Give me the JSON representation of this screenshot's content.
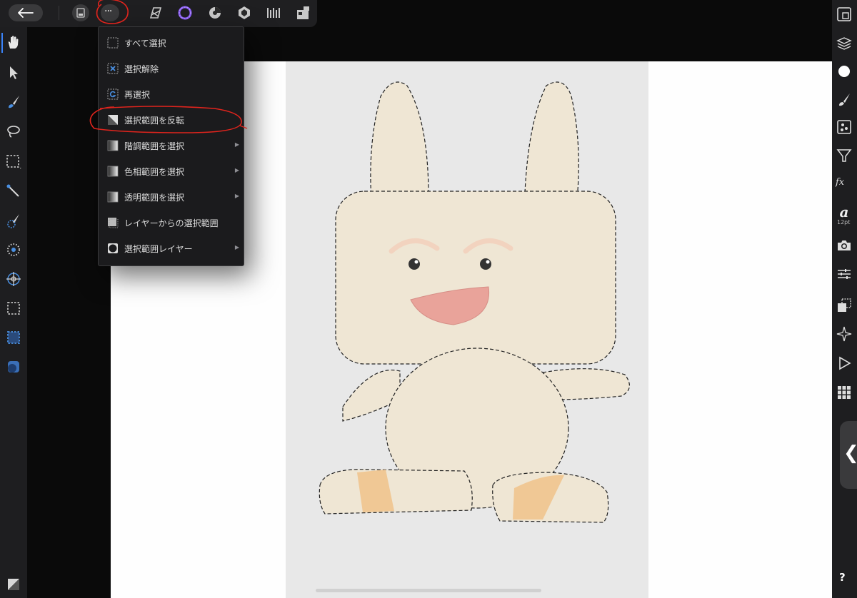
{
  "toolbar": {
    "back_icon": "arrow-left-icon",
    "document_icon": "document-icon",
    "more_icon": "ellipsis-icon",
    "more_label": "···",
    "personas": [
      "photo-persona-icon",
      "liquify-persona-icon",
      "develop-persona-icon",
      "tone-mapping-persona-icon",
      "export-persona-icon",
      "macro-persona-icon"
    ]
  },
  "select_menu": {
    "items": [
      {
        "label": "すべて選択",
        "icon": "select-all-icon",
        "submenu": false
      },
      {
        "label": "選択解除",
        "icon": "deselect-icon",
        "submenu": false
      },
      {
        "label": "再選択",
        "icon": "reselect-icon",
        "submenu": false
      },
      {
        "label": "選択範囲を反転",
        "icon": "invert-selection-icon",
        "submenu": false
      },
      {
        "label": "階調範囲を選択",
        "icon": "tonal-range-icon",
        "submenu": true
      },
      {
        "label": "色相範囲を選択",
        "icon": "color-range-icon",
        "submenu": true
      },
      {
        "label": "透明範囲を選択",
        "icon": "transparency-range-icon",
        "submenu": true
      },
      {
        "label": "レイヤーからの選択範囲",
        "icon": "selection-from-layer-icon",
        "submenu": false
      },
      {
        "label": "選択範囲レイヤー",
        "icon": "selection-layer-icon",
        "submenu": true
      }
    ],
    "submenu_arrow": "▶"
  },
  "left_tools": [
    "hand-tool-icon",
    "move-tool-icon",
    "paint-brush-tool-icon",
    "lasso-tool-icon",
    "rectangle-marquee-icon",
    "magic-wand-icon",
    "selection-brush-icon",
    "flood-select-icon",
    "refine-icon",
    "marquee-alt-icon",
    "marquee-active-icon",
    "shape-tool-icon",
    "color-swatch-icon"
  ],
  "right_tools": {
    "icons": [
      "navigator-icon",
      "layers-icon",
      "color-icon",
      "brushes-icon",
      "channels-icon",
      "filter-icon",
      "fx-icon",
      "text-style-icon",
      "camera-icon",
      "adjustments-icon",
      "transform-icon",
      "snapping-icon",
      "play-icon",
      "grid-icon"
    ],
    "fx_label": "fx",
    "font_glyph": "a",
    "font_size": "12pt",
    "expand_label": "❮",
    "help_label": "?"
  },
  "colors": {
    "panel": "#1e1e20",
    "menu_bg": "#1b1b1d",
    "accent": "#3a82f7",
    "annotation": "#e0241d",
    "character_body": "#efe6d4"
  }
}
